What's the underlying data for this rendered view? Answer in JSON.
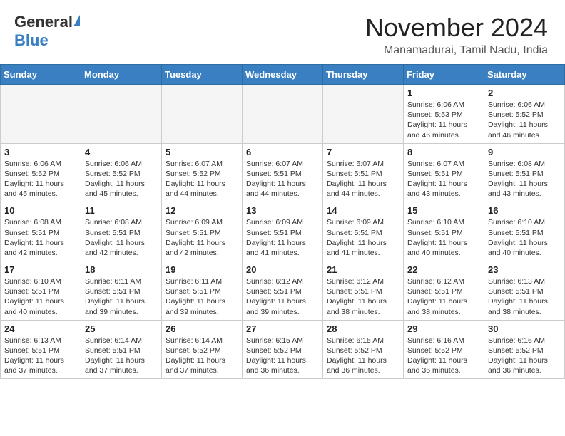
{
  "header": {
    "logo_general": "General",
    "logo_blue": "Blue",
    "title": "November 2024",
    "location": "Manamadurai, Tamil Nadu, India"
  },
  "weekdays": [
    "Sunday",
    "Monday",
    "Tuesday",
    "Wednesday",
    "Thursday",
    "Friday",
    "Saturday"
  ],
  "weeks": [
    [
      {
        "day": "",
        "info": ""
      },
      {
        "day": "",
        "info": ""
      },
      {
        "day": "",
        "info": ""
      },
      {
        "day": "",
        "info": ""
      },
      {
        "day": "",
        "info": ""
      },
      {
        "day": "1",
        "info": "Sunrise: 6:06 AM\nSunset: 5:53 PM\nDaylight: 11 hours\nand 46 minutes."
      },
      {
        "day": "2",
        "info": "Sunrise: 6:06 AM\nSunset: 5:52 PM\nDaylight: 11 hours\nand 46 minutes."
      }
    ],
    [
      {
        "day": "3",
        "info": "Sunrise: 6:06 AM\nSunset: 5:52 PM\nDaylight: 11 hours\nand 45 minutes."
      },
      {
        "day": "4",
        "info": "Sunrise: 6:06 AM\nSunset: 5:52 PM\nDaylight: 11 hours\nand 45 minutes."
      },
      {
        "day": "5",
        "info": "Sunrise: 6:07 AM\nSunset: 5:52 PM\nDaylight: 11 hours\nand 44 minutes."
      },
      {
        "day": "6",
        "info": "Sunrise: 6:07 AM\nSunset: 5:51 PM\nDaylight: 11 hours\nand 44 minutes."
      },
      {
        "day": "7",
        "info": "Sunrise: 6:07 AM\nSunset: 5:51 PM\nDaylight: 11 hours\nand 44 minutes."
      },
      {
        "day": "8",
        "info": "Sunrise: 6:07 AM\nSunset: 5:51 PM\nDaylight: 11 hours\nand 43 minutes."
      },
      {
        "day": "9",
        "info": "Sunrise: 6:08 AM\nSunset: 5:51 PM\nDaylight: 11 hours\nand 43 minutes."
      }
    ],
    [
      {
        "day": "10",
        "info": "Sunrise: 6:08 AM\nSunset: 5:51 PM\nDaylight: 11 hours\nand 42 minutes."
      },
      {
        "day": "11",
        "info": "Sunrise: 6:08 AM\nSunset: 5:51 PM\nDaylight: 11 hours\nand 42 minutes."
      },
      {
        "day": "12",
        "info": "Sunrise: 6:09 AM\nSunset: 5:51 PM\nDaylight: 11 hours\nand 42 minutes."
      },
      {
        "day": "13",
        "info": "Sunrise: 6:09 AM\nSunset: 5:51 PM\nDaylight: 11 hours\nand 41 minutes."
      },
      {
        "day": "14",
        "info": "Sunrise: 6:09 AM\nSunset: 5:51 PM\nDaylight: 11 hours\nand 41 minutes."
      },
      {
        "day": "15",
        "info": "Sunrise: 6:10 AM\nSunset: 5:51 PM\nDaylight: 11 hours\nand 40 minutes."
      },
      {
        "day": "16",
        "info": "Sunrise: 6:10 AM\nSunset: 5:51 PM\nDaylight: 11 hours\nand 40 minutes."
      }
    ],
    [
      {
        "day": "17",
        "info": "Sunrise: 6:10 AM\nSunset: 5:51 PM\nDaylight: 11 hours\nand 40 minutes."
      },
      {
        "day": "18",
        "info": "Sunrise: 6:11 AM\nSunset: 5:51 PM\nDaylight: 11 hours\nand 39 minutes."
      },
      {
        "day": "19",
        "info": "Sunrise: 6:11 AM\nSunset: 5:51 PM\nDaylight: 11 hours\nand 39 minutes."
      },
      {
        "day": "20",
        "info": "Sunrise: 6:12 AM\nSunset: 5:51 PM\nDaylight: 11 hours\nand 39 minutes."
      },
      {
        "day": "21",
        "info": "Sunrise: 6:12 AM\nSunset: 5:51 PM\nDaylight: 11 hours\nand 38 minutes."
      },
      {
        "day": "22",
        "info": "Sunrise: 6:12 AM\nSunset: 5:51 PM\nDaylight: 11 hours\nand 38 minutes."
      },
      {
        "day": "23",
        "info": "Sunrise: 6:13 AM\nSunset: 5:51 PM\nDaylight: 11 hours\nand 38 minutes."
      }
    ],
    [
      {
        "day": "24",
        "info": "Sunrise: 6:13 AM\nSunset: 5:51 PM\nDaylight: 11 hours\nand 37 minutes."
      },
      {
        "day": "25",
        "info": "Sunrise: 6:14 AM\nSunset: 5:51 PM\nDaylight: 11 hours\nand 37 minutes."
      },
      {
        "day": "26",
        "info": "Sunrise: 6:14 AM\nSunset: 5:52 PM\nDaylight: 11 hours\nand 37 minutes."
      },
      {
        "day": "27",
        "info": "Sunrise: 6:15 AM\nSunset: 5:52 PM\nDaylight: 11 hours\nand 36 minutes."
      },
      {
        "day": "28",
        "info": "Sunrise: 6:15 AM\nSunset: 5:52 PM\nDaylight: 11 hours\nand 36 minutes."
      },
      {
        "day": "29",
        "info": "Sunrise: 6:16 AM\nSunset: 5:52 PM\nDaylight: 11 hours\nand 36 minutes."
      },
      {
        "day": "30",
        "info": "Sunrise: 6:16 AM\nSunset: 5:52 PM\nDaylight: 11 hours\nand 36 minutes."
      }
    ]
  ]
}
